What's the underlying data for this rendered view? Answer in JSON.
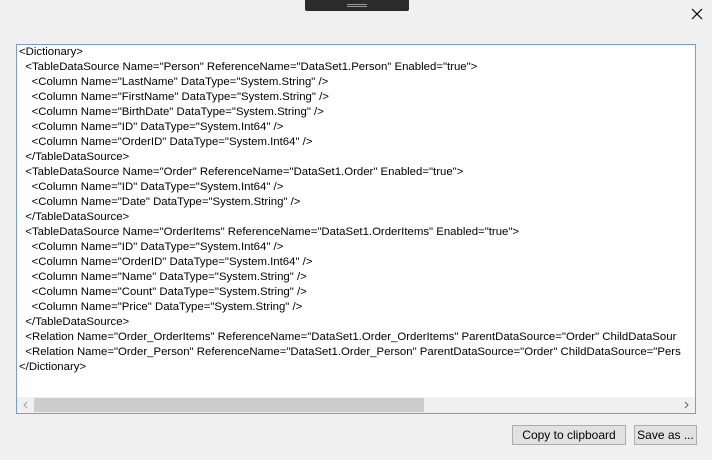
{
  "dialog": {
    "close_icon": "close-icon",
    "copy_button_label": "Copy to clipboard",
    "save_button_label": "Save as ..."
  },
  "xml_lines": [
    "<Dictionary>",
    "  <TableDataSource Name=\"Person\" ReferenceName=\"DataSet1.Person\" Enabled=\"true\">",
    "    <Column Name=\"LastName\" DataType=\"System.String\" />",
    "    <Column Name=\"FirstName\" DataType=\"System.String\" />",
    "    <Column Name=\"BirthDate\" DataType=\"System.String\" />",
    "    <Column Name=\"ID\" DataType=\"System.Int64\" />",
    "    <Column Name=\"OrderID\" DataType=\"System.Int64\" />",
    "  </TableDataSource>",
    "  <TableDataSource Name=\"Order\" ReferenceName=\"DataSet1.Order\" Enabled=\"true\">",
    "    <Column Name=\"ID\" DataType=\"System.Int64\" />",
    "    <Column Name=\"Date\" DataType=\"System.String\" />",
    "  </TableDataSource>",
    "  <TableDataSource Name=\"OrderItems\" ReferenceName=\"DataSet1.OrderItems\" Enabled=\"true\">",
    "    <Column Name=\"ID\" DataType=\"System.Int64\" />",
    "    <Column Name=\"OrderID\" DataType=\"System.Int64\" />",
    "    <Column Name=\"Name\" DataType=\"System.String\" />",
    "    <Column Name=\"Count\" DataType=\"System.String\" />",
    "    <Column Name=\"Price\" DataType=\"System.String\" />",
    "  </TableDataSource>",
    "  <Relation Name=\"Order_OrderItems\" ReferenceName=\"DataSet1.Order_OrderItems\" ParentDataSource=\"Order\" ChildDataSour",
    "  <Relation Name=\"Order_Person\" ReferenceName=\"DataSet1.Order_Person\" ParentDataSource=\"Order\" ChildDataSource=\"Pers",
    "</Dictionary>"
  ],
  "scrollbar": {
    "left_arrow_icon": "chevron-left-icon",
    "right_arrow_icon": "chevron-right-icon",
    "position_fraction": 0.0,
    "visible_fraction": 0.6
  },
  "colors": {
    "window_bg": "#f0f0f0",
    "text_area_border": "#7a9cd3",
    "button_bg": "#e1e1e1",
    "button_border": "#adadad"
  }
}
